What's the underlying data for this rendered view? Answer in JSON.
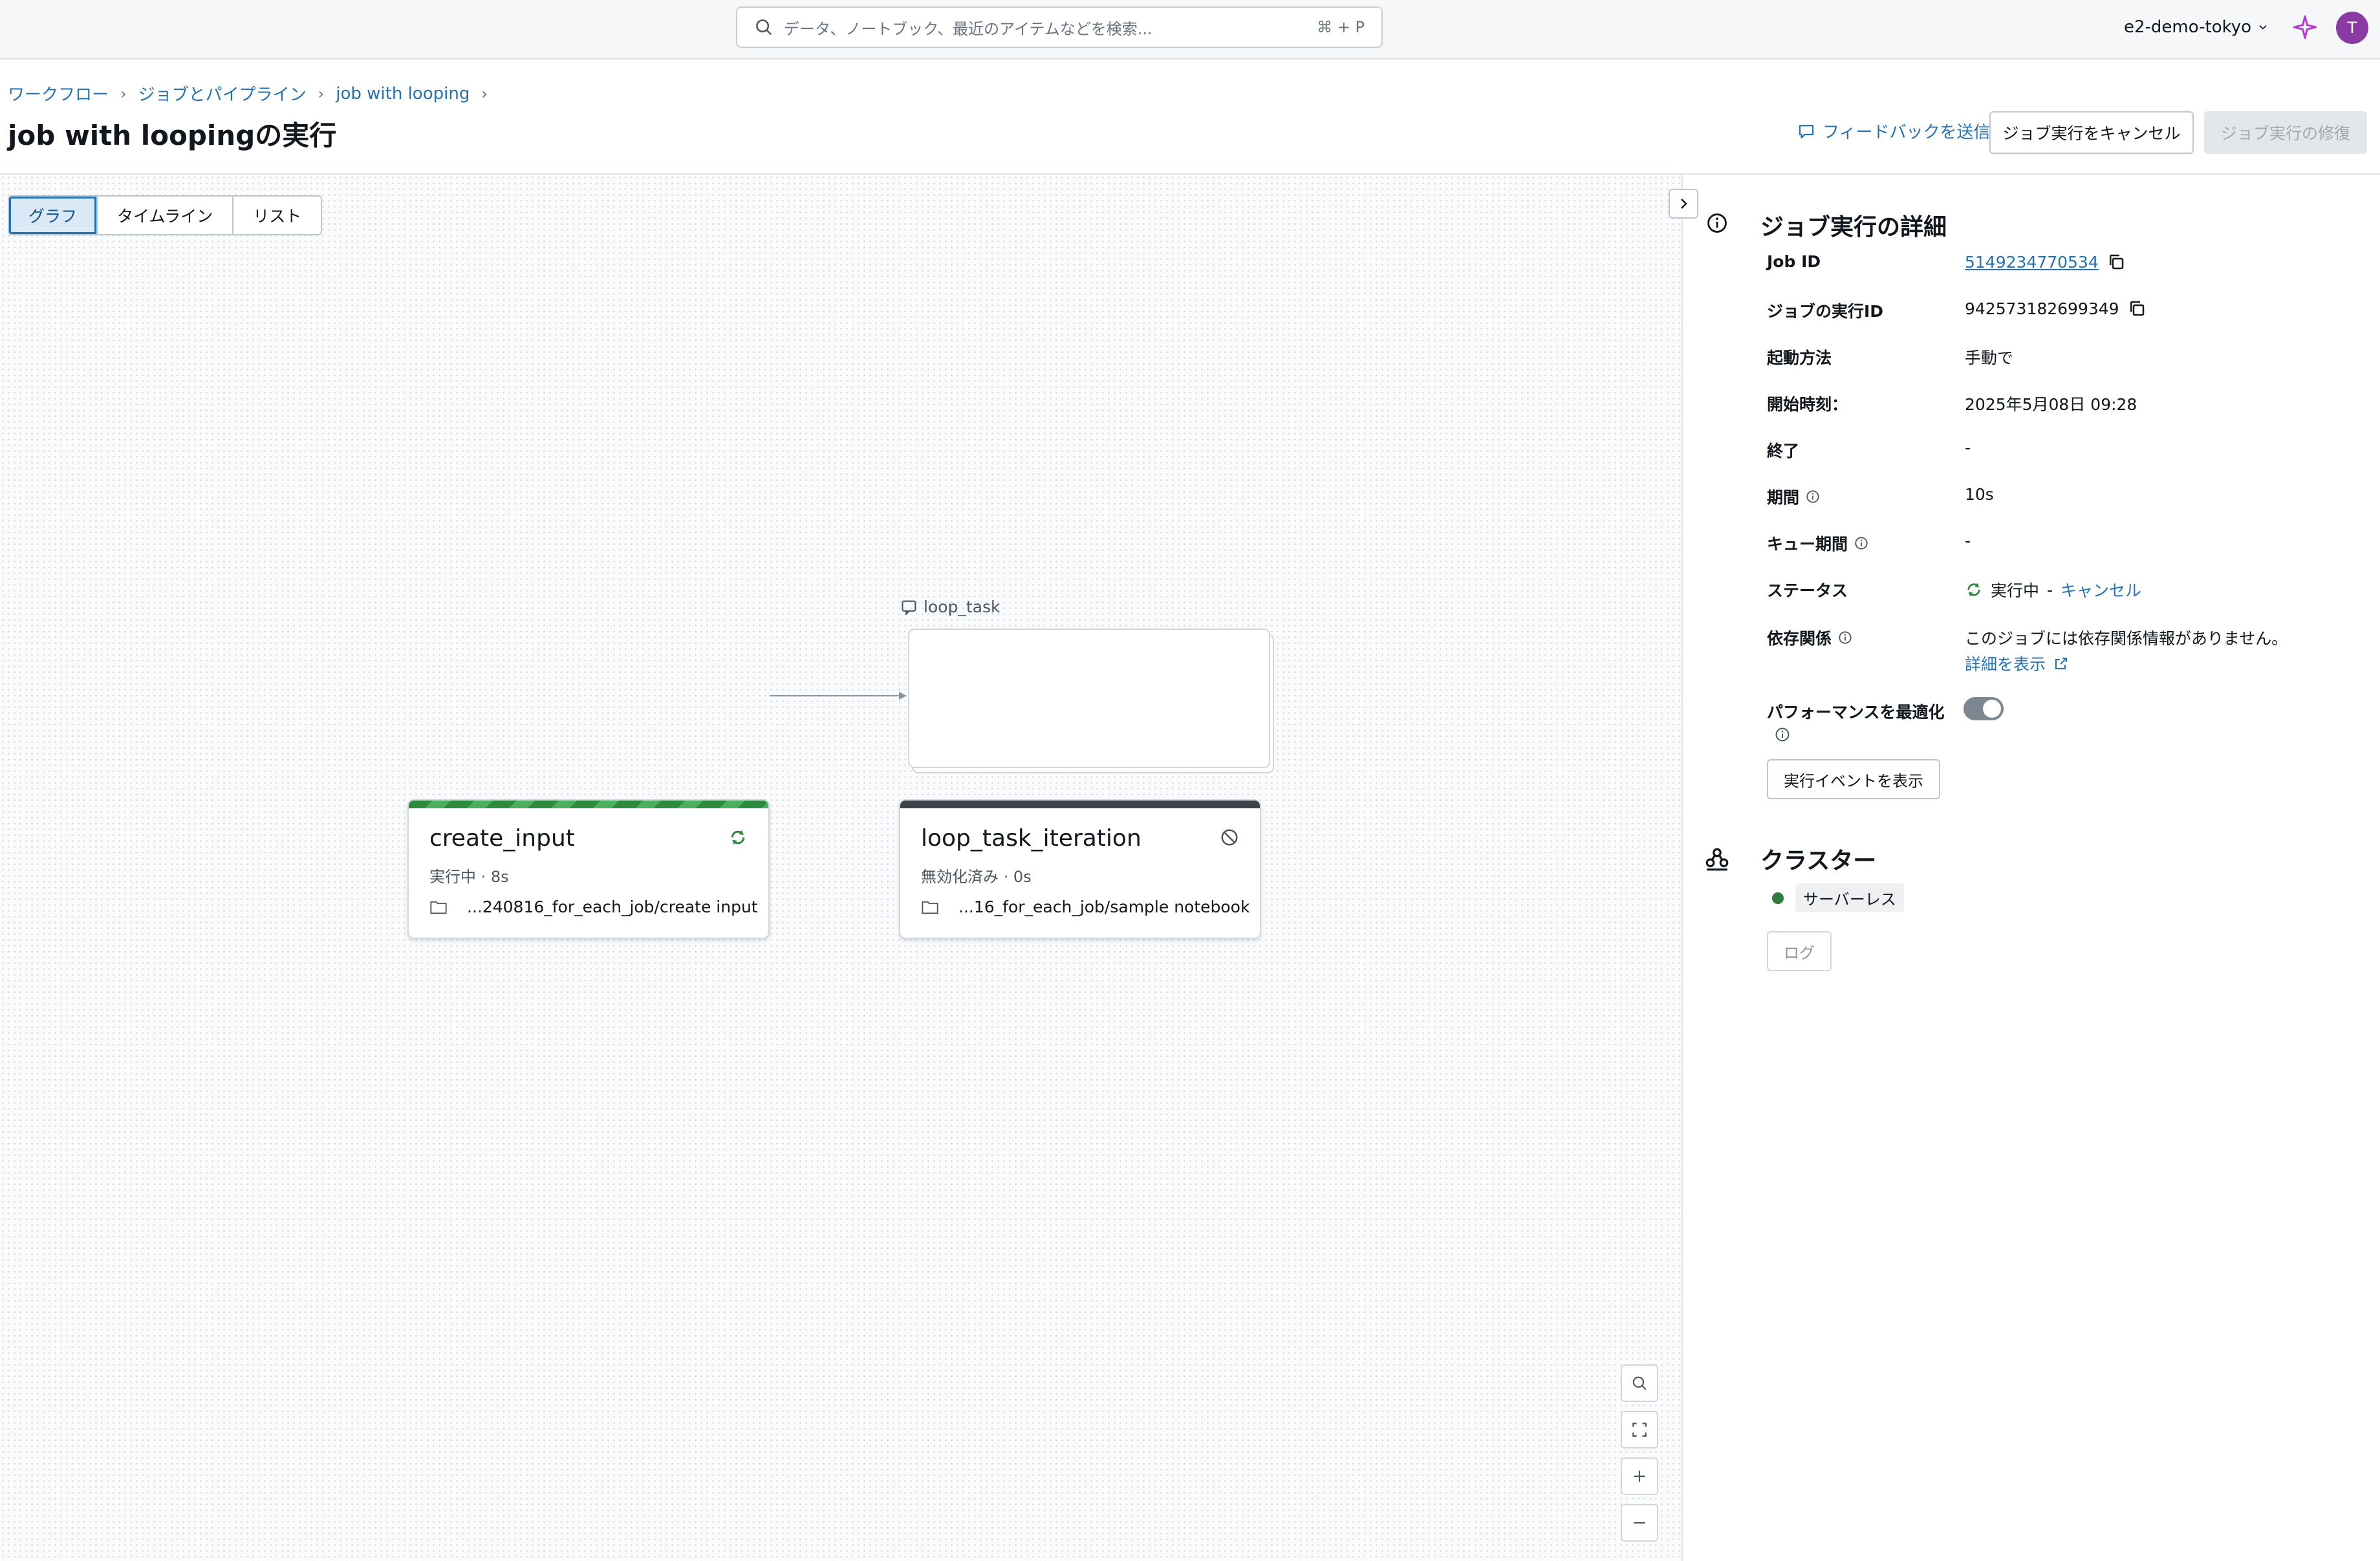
{
  "topbar": {
    "search_placeholder": "データ、ノートブック、最近のアイテムなどを検索...",
    "search_shortcut": "⌘ + P",
    "workspace": "e2-demo-tokyo",
    "avatar_initial": "T"
  },
  "breadcrumb": [
    "ワークフロー",
    "ジョブとパイプライン",
    "job with looping"
  ],
  "header": {
    "title": "job with loopingの実行",
    "feedback": "フィードバックを送信",
    "cancel_run": "ジョブ実行をキャンセル",
    "repair_run": "ジョブ実行の修復"
  },
  "view_tabs": [
    "グラフ",
    "タイムライン",
    "リスト"
  ],
  "active_tab": "グラフ",
  "graph": {
    "nodes": [
      {
        "name": "create_input",
        "status": "実行中",
        "duration": "8s",
        "path": "...240816_for_each_job/create input",
        "state_color": "#2d8a3e"
      },
      {
        "group_label": "loop_task",
        "name": "loop_task_iteration",
        "status": "無効化済み",
        "duration": "0s",
        "path": "...16_for_each_job/sample notebook",
        "state_color": "#3d4248"
      }
    ]
  },
  "details": {
    "title": "ジョブ実行の詳細",
    "rows": [
      {
        "label": "Job ID",
        "value": "5149234770534"
      },
      {
        "label": "ジョブの実行ID",
        "value": "942573182699349"
      },
      {
        "label": "起動方法",
        "value": "手動で"
      },
      {
        "label": "開始時刻：",
        "value": "2025年5月08日 09:28"
      },
      {
        "label": "終了",
        "value": "-"
      },
      {
        "label": "期間",
        "value": "10s"
      },
      {
        "label": "キュー期間",
        "value": "-"
      },
      {
        "label": "ステータス",
        "value": "実行中",
        "action": "キャンセル"
      },
      {
        "label": "依存関係",
        "value": "このジョブには依存関係情報がありません。",
        "link": "詳細を表示"
      },
      {
        "label": "パフォーマンスを最適化",
        "toggle_on": true
      }
    ],
    "events_button": "実行イベントを表示"
  },
  "cluster": {
    "title": "クラスター",
    "type": "サーバーレス",
    "log_button": "ログ"
  },
  "colors": {
    "accent": "#2272b4",
    "running": "#2d8a3e",
    "avatar": "#8a3aa3"
  }
}
